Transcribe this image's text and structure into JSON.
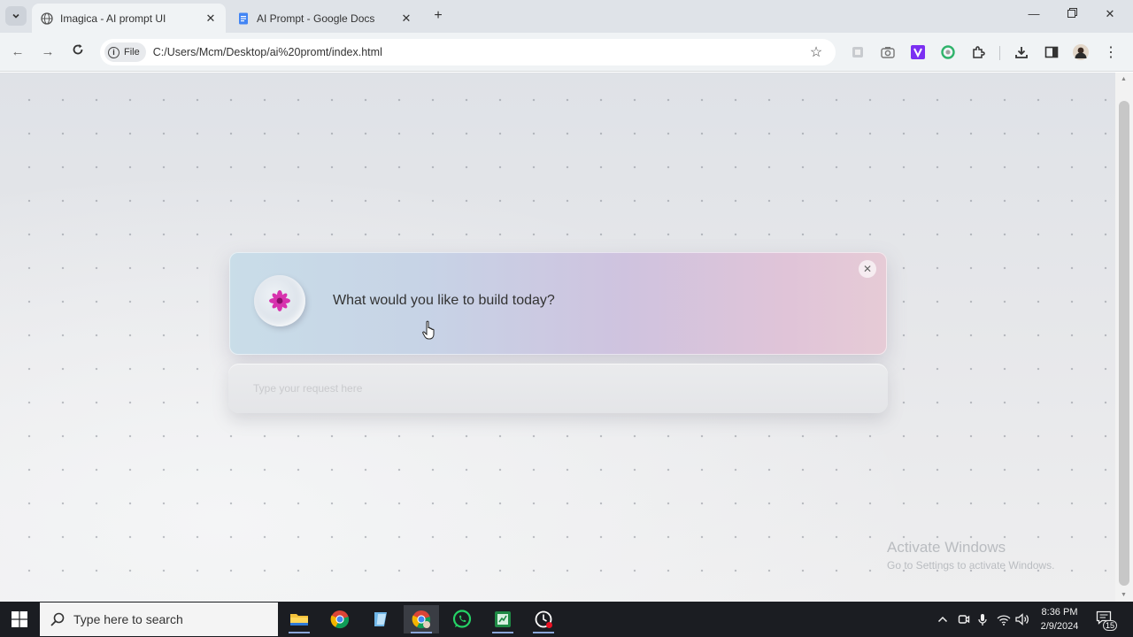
{
  "browser": {
    "tabs": [
      {
        "title": "Imagica - AI prompt UI",
        "active": true,
        "icon": "globe-icon"
      },
      {
        "title": "AI Prompt - Google Docs",
        "active": false,
        "icon": "google-docs-icon"
      }
    ],
    "address_chip": "File",
    "url": "C:/Users/Mcm/Desktop/ai%20promt/index.html"
  },
  "page": {
    "prompt_title": "What would you like to build today?",
    "input_placeholder": "Type your request here",
    "input_value": ""
  },
  "watermark": {
    "line1": "Activate Windows",
    "line2": "Go to Settings to activate Windows."
  },
  "taskbar": {
    "search_placeholder": "Type here to search",
    "time": "8:36 PM",
    "date": "2/9/2024",
    "notification_count": "15",
    "apps": [
      "file-explorer",
      "chrome",
      "notepad-app",
      "chrome-profile",
      "whatsapp",
      "excel-app",
      "clock-app"
    ]
  },
  "colors": {
    "card_gradient_start": "#c9dde8",
    "card_gradient_end": "#e6cbd6",
    "flower": "#d61fa7",
    "taskbar_bg": "#1b1d22"
  }
}
